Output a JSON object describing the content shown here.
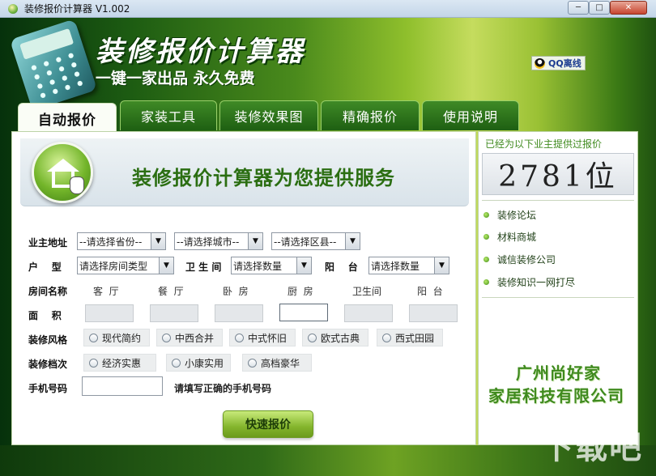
{
  "window": {
    "title": "装修报价计算器  V1.002",
    "controls": {
      "minimize": "─",
      "maximize": "□",
      "close": "✕"
    }
  },
  "banner": {
    "title": "装修报价计算器",
    "slogan": "一键一家出品 永久免费",
    "qq_link": "QQ离线"
  },
  "tabs": [
    {
      "label": "自动报价",
      "active": true
    },
    {
      "label": "家装工具",
      "active": false
    },
    {
      "label": "装修效果图",
      "active": false
    },
    {
      "label": "精确报价",
      "active": false
    },
    {
      "label": "使用说明",
      "active": false
    }
  ],
  "main": {
    "service_text": "装修报价计算器为您提供服务",
    "address": {
      "label": "业主地址",
      "province": "--请选择省份--",
      "city": "--请选择城市--",
      "district": "--请选择区县--"
    },
    "house": {
      "type_label": "户    型",
      "type_value": "请选择房间类型",
      "bath_label": "卫 生 间",
      "bath_value": "请选择数量",
      "balcony_label": "阳    台",
      "balcony_value": "请选择数量"
    },
    "rooms": {
      "label": "房间名称",
      "names": [
        "客  厅",
        "餐  厅",
        "卧  房",
        "厨  房",
        "卫生间",
        "阳  台"
      ]
    },
    "area_label": "面    积",
    "style": {
      "label": "装修风格",
      "options": [
        "现代简约",
        "中西合并",
        "中式怀旧",
        "欧式古典",
        "西式田园"
      ]
    },
    "grade": {
      "label": "装修档次",
      "options": [
        "经济实惠",
        "小康实用",
        "高档豪华"
      ]
    },
    "phone": {
      "label": "手机号码",
      "value": "",
      "hint": "请填写正确的手机号码"
    },
    "submit_label": "快速报价"
  },
  "side": {
    "caption": "已经为以下业主提供过报价",
    "counter": "2781位",
    "links": [
      "装修论坛",
      "材料商城",
      "诚信装修公司",
      "装修知识一网打尽"
    ],
    "company_line1": "广州尚好家",
    "company_line2": "家居科技有限公司"
  },
  "watermark": "下载吧",
  "colors": {
    "accent_green": "#3f8a1e",
    "tab_green": "#1e5f12",
    "service_text": "#2b6e12"
  }
}
